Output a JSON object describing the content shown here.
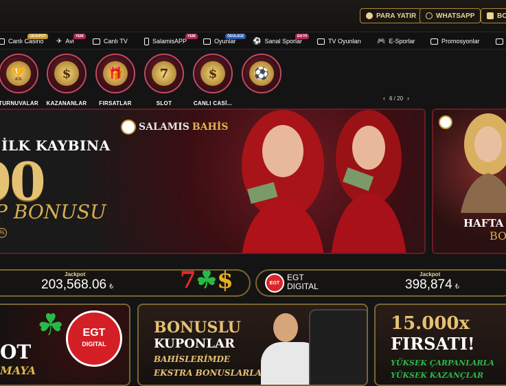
{
  "colors": {
    "accent_gold": "#e0b64c",
    "banner_red": "#6a1a26",
    "egt_red": "#d41f26"
  },
  "topbar": {
    "buttons": [
      {
        "label": "PARA YATIR",
        "icon": "coin-icon"
      },
      {
        "label": "WHATSAPP",
        "icon": "whatsapp-icon"
      },
      {
        "label": "BON",
        "icon": "gift-icon"
      }
    ]
  },
  "nav": {
    "items": [
      {
        "label": "Canlı Casino",
        "tag": "JACKPOT",
        "icon": "casino-icon"
      },
      {
        "label": "Avi",
        "tag": "YENİ",
        "icon": "plane-icon"
      },
      {
        "label": "Canlı TV",
        "tag": "",
        "icon": "tv-icon"
      },
      {
        "label": "SalamisAPP",
        "tag": "YENİ",
        "icon": "phone-icon"
      },
      {
        "label": "Oyunlar",
        "tag": "ÖDÜLSÜZ",
        "icon": "dice-icon"
      },
      {
        "label": "Sanal Sporlar",
        "tag": "EN İYİ",
        "icon": "ball-icon"
      },
      {
        "label": "TV Oyunları",
        "tag": "",
        "icon": "tv-game-icon"
      },
      {
        "label": "E-Sporlar",
        "tag": "",
        "icon": "gamepad-icon"
      },
      {
        "label": "Promosyonlar",
        "tag": "",
        "icon": "gift-icon"
      }
    ]
  },
  "categories": [
    {
      "label": "TURNUVALAR",
      "icon": "trophy-icon",
      "glyph": "🏆"
    },
    {
      "label": "KAZANANLAR",
      "icon": "money-icon",
      "glyph": "$"
    },
    {
      "label": "FIRSATLAR",
      "icon": "gift-icon",
      "glyph": "🎁"
    },
    {
      "label": "SLOT",
      "icon": "seven-icon",
      "glyph": "7"
    },
    {
      "label": "CANLI CASİ...",
      "icon": "chip-icon",
      "glyph": "$"
    },
    {
      "label": "",
      "icon": "football-icon",
      "glyph": "⚽"
    }
  ],
  "slider": {
    "pager": "6 / 20"
  },
  "banner": {
    "brand_a": "SALAMIS",
    "brand_b": "BAHİS",
    "headline": "İLK KAYBINA",
    "amount": "00",
    "bonus": "P BONUSU",
    "mark": "%"
  },
  "banner2": {
    "headline": "HAFTA",
    "sub": "BO"
  },
  "jackpot": {
    "left_label": "Jackpot",
    "left_value": "203,568.06",
    "right_label": "Jackpot",
    "right_value": "398,874",
    "currency": "₺",
    "slot_logo": "7☘$",
    "egt_logo": "EGT",
    "egt_text_1": "EGT",
    "egt_text_2": "DIGITAL"
  },
  "cards": {
    "c1_text_1": "OT",
    "c1_text_2": "MAYA",
    "c1_coin_1": "EGT",
    "c1_coin_2": "DIGITAL",
    "c2_title_1": "BONUSLU",
    "c2_title_2": "KUPONLAR",
    "c2_sub_1": "BAHİSLERİMDE",
    "c2_sub_2": "EKSTRA BONUSLARLA",
    "c3_title_1": "15.000x",
    "c3_title_2": "FIRSATI!",
    "c3_sub_1": "YÜKSEK ÇARPANLARLA",
    "c3_sub_2": "YÜKSEK KAZANÇLAR"
  }
}
